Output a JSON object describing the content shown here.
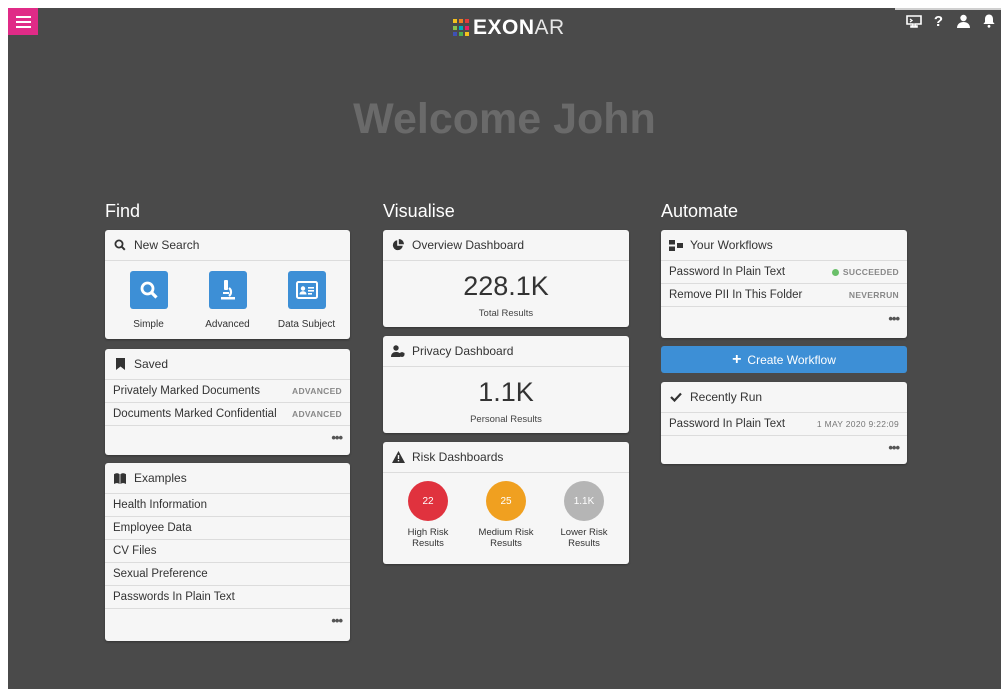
{
  "header": {
    "brand_bold": "EXON",
    "brand_thin": "AR",
    "icons": [
      "console-icon",
      "help-icon",
      "user-icon",
      "bell-icon"
    ],
    "accent_color": "#e02b87"
  },
  "welcome": "Welcome John",
  "find": {
    "title": "Find",
    "new_search": {
      "label": "New Search",
      "tiles": [
        {
          "label": "Simple",
          "icon": "search-icon"
        },
        {
          "label": "Advanced",
          "icon": "microscope-icon"
        },
        {
          "label": "Data Subject",
          "icon": "id-card-icon"
        }
      ]
    },
    "saved": {
      "label": "Saved",
      "items": [
        {
          "label": "Privately Marked Documents",
          "tag": "ADVANCED"
        },
        {
          "label": "Documents Marked Confidential",
          "tag": "ADVANCED"
        }
      ],
      "more": "•••"
    },
    "examples": {
      "label": "Examples",
      "items": [
        "Health Information",
        "Employee Data",
        "CV Files",
        "Sexual Preference",
        "Passwords In Plain Text"
      ],
      "more": "•••"
    }
  },
  "visualise": {
    "title": "Visualise",
    "overview": {
      "label": "Overview Dashboard",
      "value": "228.1K",
      "caption": "Total Results"
    },
    "privacy": {
      "label": "Privacy Dashboard",
      "value": "1.1K",
      "caption": "Personal Results"
    },
    "risk": {
      "label": "Risk Dashboards",
      "items": [
        {
          "value": "22",
          "label1": "High Risk",
          "label2": "Results",
          "color": "#e0323e"
        },
        {
          "value": "25",
          "label1": "Medium Risk",
          "label2": "Results",
          "color": "#f0a020"
        },
        {
          "value": "1.1K",
          "label1": "Lower Risk",
          "label2": "Results",
          "color": "#b5b5b5"
        }
      ]
    }
  },
  "automate": {
    "title": "Automate",
    "workflows": {
      "label": "Your Workflows",
      "items": [
        {
          "label": "Password In Plain Text",
          "status": "SUCCEEDED",
          "status_color": "#6abf69"
        },
        {
          "label": "Remove PII In This Folder",
          "status": "NEVERRUN"
        }
      ],
      "more": "•••"
    },
    "create_button": "Create Workflow",
    "recent": {
      "label": "Recently Run",
      "items": [
        {
          "label": "Password In Plain Text",
          "time": "1 MAY 2020 9:22:09"
        }
      ],
      "more": "•••"
    }
  }
}
